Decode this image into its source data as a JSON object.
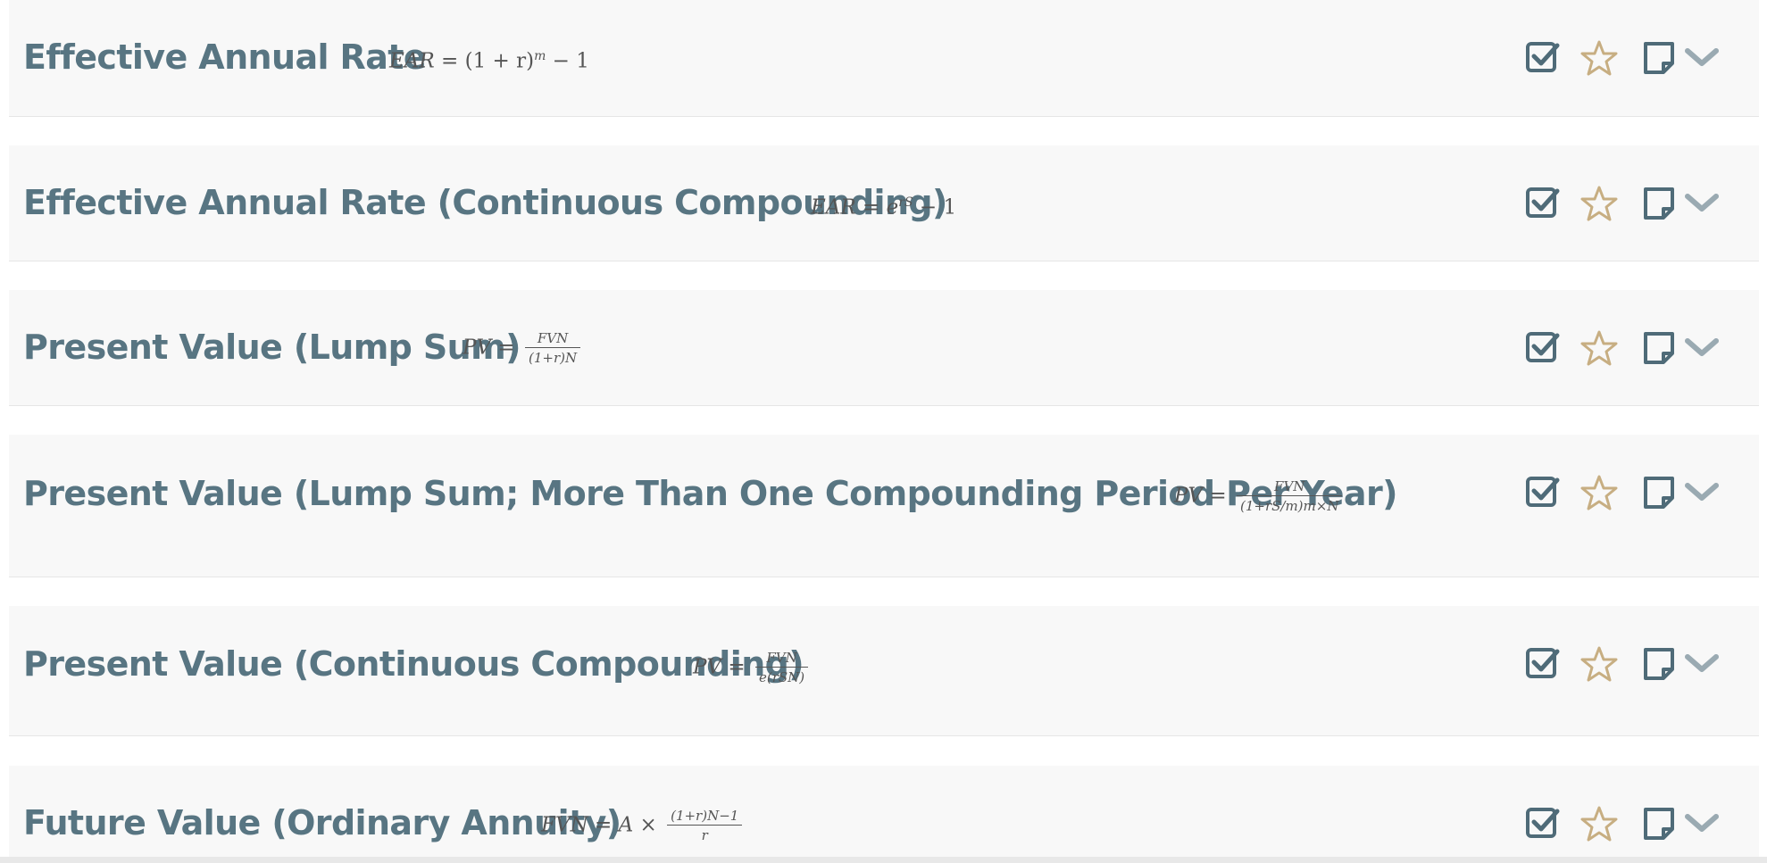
{
  "rows": [
    {
      "title": "Effective Annual Rate",
      "formula": {
        "lhs": "EAR = ",
        "rhs": "(1 + r)",
        "exp": "m",
        "tail": " − 1"
      }
    },
    {
      "title": "Effective Annual Rate (Continuous Compounding)",
      "formula": {
        "lhs": "EAR = ",
        "rhs": "e",
        "exp": "rS",
        "tail": " − 1"
      }
    },
    {
      "title": "Present Value (Lump Sum)",
      "formula": {
        "lhs": "PV = ",
        "num": "FVN",
        "den": "(1+r)N"
      }
    },
    {
      "title": "Present Value (Lump Sum; More Than One Compounding Period Per Year)",
      "formula": {
        "lhs": "PV = ",
        "num": "FVN",
        "den": "(1+rS/m)m×N"
      }
    },
    {
      "title": "Present Value (Continuous Compounding)",
      "formula": {
        "lhs": "PV = ",
        "num": "FVN",
        "den": "e(rSN)"
      }
    },
    {
      "title": "Future Value (Ordinary Annuity)",
      "formula": {
        "lhs": "FVN = A × ",
        "num": "(1+r)N−1",
        "den": "r"
      }
    }
  ],
  "icons": {
    "check": "check-square-icon",
    "star": "star-outline-icon",
    "note": "sticky-note-icon",
    "chevron": "chevron-down-icon"
  },
  "colors": {
    "title": "#587582",
    "icon": "#4f6b78",
    "star": "#c7ae82",
    "chevron": "#9aaab2",
    "row_bg": "#f8f8f8"
  }
}
